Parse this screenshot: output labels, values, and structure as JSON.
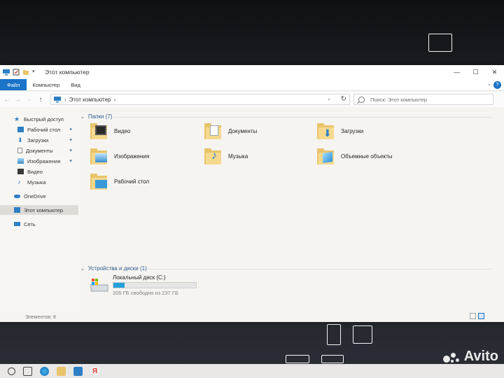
{
  "window": {
    "title": "Этот компьютер",
    "controls": {
      "minimize": "—",
      "maximize": "☐",
      "close": "✕"
    }
  },
  "ribbon": {
    "tabs": [
      "Файл",
      "Компьютер",
      "Вид"
    ],
    "help": "?"
  },
  "navigation": {
    "back": "←",
    "forward": "→",
    "recent": "⌄",
    "up": "↑",
    "address_separator": "›",
    "address_text": "Этот компьютер",
    "address_chevron": "›",
    "dropdown": "⌄",
    "refresh": "↻",
    "search_placeholder": "Поиск: Этот компьютер"
  },
  "sidebar": {
    "items": [
      {
        "label": "Быстрый доступ",
        "pinned": false,
        "icon": "star-icon"
      },
      {
        "label": "Рабочий стол",
        "pinned": true,
        "icon": "desktop-icon"
      },
      {
        "label": "Загрузки",
        "pinned": true,
        "icon": "download-icon"
      },
      {
        "label": "Документы",
        "pinned": true,
        "icon": "document-icon"
      },
      {
        "label": "Изображения",
        "pinned": true,
        "icon": "picture-icon"
      },
      {
        "label": "Видео",
        "pinned": false,
        "icon": "video-icon"
      },
      {
        "label": "Музыка",
        "pinned": false,
        "icon": "music-icon"
      },
      {
        "label": "OneDrive",
        "pinned": false,
        "icon": "cloud-icon"
      },
      {
        "label": "Этот компьютер",
        "pinned": false,
        "icon": "computer-icon",
        "selected": true
      },
      {
        "label": "Сеть",
        "pinned": false,
        "icon": "network-icon"
      }
    ],
    "pin_glyph": "📌"
  },
  "content": {
    "folders_header": "Папки (7)",
    "folders": [
      {
        "label": "Видео",
        "overlay": "video"
      },
      {
        "label": "Документы",
        "overlay": "document"
      },
      {
        "label": "Загрузки",
        "overlay": "download"
      },
      {
        "label": "Изображения",
        "overlay": "picture"
      },
      {
        "label": "Музыка",
        "overlay": "music"
      },
      {
        "label": "Объемные объекты",
        "overlay": "3d"
      },
      {
        "label": "Рабочий стол",
        "overlay": "desktop"
      }
    ],
    "devices_header": "Устройства и диски (1)",
    "drive": {
      "name": "Локальный диск (C:)",
      "free_text": "205 ГБ свободно из 237 ГБ",
      "used_fraction": 0.135
    }
  },
  "status": {
    "items": "Элементов: 8"
  },
  "colors": {
    "accent": "#1a73c7",
    "folder": "#e8c46a",
    "drive_fill": "#26a0da"
  },
  "watermark": "Avito"
}
